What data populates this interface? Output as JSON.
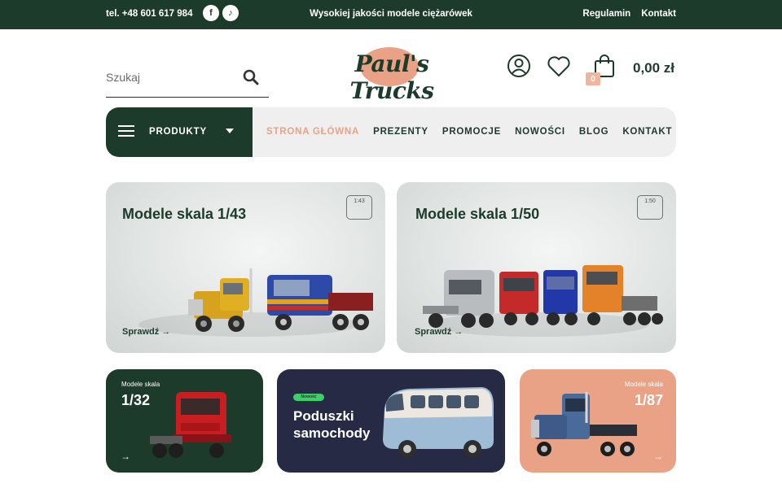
{
  "topbar": {
    "phone": "tel. +48 601 617 984",
    "social_facebook": "f",
    "social_tiktok": "♪",
    "promo": "Wysokiej jakości modele ciężarówek",
    "links": [
      "Regulamin",
      "Kontakt"
    ]
  },
  "header": {
    "search_placeholder": "Szukaj",
    "logo": "Paul's Trucks",
    "cart_count": "0",
    "cart_total": "0,00 zł"
  },
  "nav": {
    "products_label": "PRODUKTY",
    "items": [
      "STRONA GŁÓWNA",
      "PREZENTY",
      "PROMOCJE",
      "NOWOŚCI",
      "BLOG",
      "KONTAKT"
    ],
    "active_index": 0
  },
  "tiles": {
    "scale43": {
      "title": "Modele skala 1/43",
      "cta": "Sprawdź",
      "badge": "1:43"
    },
    "scale50": {
      "title": "Modele skala 1/50",
      "cta": "Sprawdź",
      "badge": "1:50"
    },
    "scale32": {
      "subtitle": "Modele skala",
      "title": "1/32"
    },
    "pillows": {
      "tag": "Nowość",
      "title_line1": "Poduszki",
      "title_line2": "samochody"
    },
    "scale87": {
      "subtitle": "Modele skala",
      "title": "1/87"
    }
  },
  "colors": {
    "brand_green": "#1c3b2b",
    "accent_peach": "#e9a286",
    "navy_tile": "#262a44",
    "tag_green": "#3ecf6a"
  }
}
